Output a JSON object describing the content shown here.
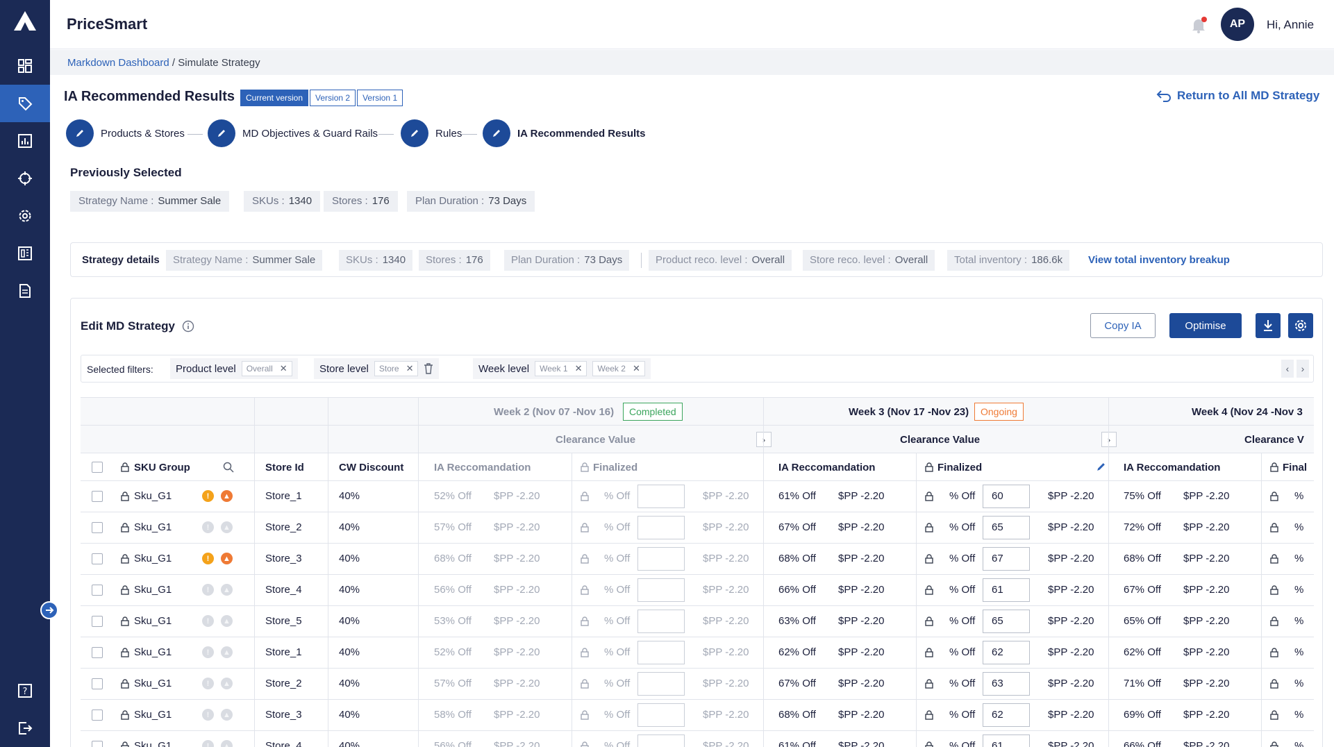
{
  "app": {
    "title": "PriceSmart"
  },
  "header": {
    "avatar_initials": "AP",
    "greeting": "Hi, Annie"
  },
  "breadcrumb": {
    "parent": "Markdown Dashboard",
    "separator": " / ",
    "current": "Simulate Strategy"
  },
  "page": {
    "title": "IA Recommended Results",
    "versions": [
      "Current version",
      "Version 2",
      "Version 1"
    ],
    "return_link": "Return to All MD Strategy"
  },
  "steps": [
    "Products & Stores",
    "MD Objectives & Guard Rails",
    "Rules",
    "IA Recommended Results"
  ],
  "previously_selected": {
    "title": "Previously Selected",
    "chips": [
      {
        "label": "Strategy Name :",
        "value": "Summer Sale"
      },
      {
        "label": "SKUs :",
        "value": "1340"
      },
      {
        "label": "Stores :",
        "value": "176"
      },
      {
        "label": "Plan Duration :",
        "value": "73 Days"
      }
    ]
  },
  "strategy_details": {
    "label": "Strategy details",
    "chips": [
      {
        "label": "Strategy Name :",
        "value": "Summer Sale"
      },
      {
        "label": "SKUs :",
        "value": "1340"
      },
      {
        "label": "Stores :",
        "value": "176"
      },
      {
        "label": "Plan Duration :",
        "value": "73 Days"
      },
      {
        "label": "Product reco. level :",
        "value": "Overall"
      },
      {
        "label": "Store reco. level :",
        "value": "Overall"
      },
      {
        "label": "Total inventory :",
        "value": "186.6k"
      }
    ],
    "breakup_link": "View total inventory breakup"
  },
  "edit_panel": {
    "title": "Edit MD Strategy",
    "copy_label": "Copy IA",
    "optimise_label": "Optimise",
    "filters_label": "Selected filters:",
    "filters": [
      {
        "name": "Product level",
        "tags": [
          "Overall"
        ]
      },
      {
        "name": "Store level",
        "tags": [
          "Store"
        ]
      },
      {
        "name": "Week level",
        "tags": [
          "Week 1",
          "Week 2"
        ]
      }
    ]
  },
  "table": {
    "columns": {
      "sku_group": "SKU Group",
      "store_id": "Store Id",
      "cw_discount": "CW Discount"
    },
    "weeks": [
      {
        "title": "Week 2 (Nov 07 -Nov 16)",
        "status": "Completed",
        "group": "Clearance Value",
        "reco_label": "IA Reccomandation",
        "final_label": "Finalized"
      },
      {
        "title": "Week 3 (Nov 17 -Nov 23)",
        "status": "Ongoing",
        "group": "Clearance Value",
        "reco_label": "IA Reccomandation",
        "final_label": "Finalized"
      },
      {
        "title": "Week 4 (Nov 24 -Nov 3",
        "status": "",
        "group": "Clearance V",
        "reco_label": "IA Reccomandation",
        "final_label": "Final"
      }
    ],
    "unit_off": "% Off",
    "unit_pct": "%",
    "rows": [
      {
        "sku": "Sku_G1",
        "store": "Store_1",
        "cw": "40%",
        "flag": true,
        "w2_reco": "52% Off",
        "w2_price": "$PP -2.20",
        "w2_fprice": "$PP -2.20",
        "w3_reco": "61% Off",
        "w3_price": "$PP -2.20",
        "w3_val": "60",
        "w3_fprice": "$PP -2.20",
        "w4_reco": "75% Off",
        "w4_price": "$PP -2.20"
      },
      {
        "sku": "Sku_G1",
        "store": "Store_2",
        "cw": "40%",
        "flag": false,
        "w2_reco": "57% Off",
        "w2_price": "$PP -2.20",
        "w2_fprice": "$PP -2.20",
        "w3_reco": "67% Off",
        "w3_price": "$PP -2.20",
        "w3_val": "65",
        "w3_fprice": "$PP -2.20",
        "w4_reco": "72% Off",
        "w4_price": "$PP -2.20"
      },
      {
        "sku": "Sku_G1",
        "store": "Store_3",
        "cw": "40%",
        "flag": true,
        "w2_reco": "68% Off",
        "w2_price": "$PP -2.20",
        "w2_fprice": "$PP -2.20",
        "w3_reco": "68% Off",
        "w3_price": "$PP -2.20",
        "w3_val": "67",
        "w3_fprice": "$PP -2.20",
        "w4_reco": "68% Off",
        "w4_price": "$PP -2.20"
      },
      {
        "sku": "Sku_G1",
        "store": "Store_4",
        "cw": "40%",
        "flag": false,
        "w2_reco": "56% Off",
        "w2_price": "$PP -2.20",
        "w2_fprice": "$PP -2.20",
        "w3_reco": "66% Off",
        "w3_price": "$PP -2.20",
        "w3_val": "61",
        "w3_fprice": "$PP -2.20",
        "w4_reco": "67% Off",
        "w4_price": "$PP -2.20"
      },
      {
        "sku": "Sku_G1",
        "store": "Store_5",
        "cw": "40%",
        "flag": false,
        "w2_reco": "53% Off",
        "w2_price": "$PP -2.20",
        "w2_fprice": "$PP -2.20",
        "w3_reco": "63% Off",
        "w3_price": "$PP -2.20",
        "w3_val": "65",
        "w3_fprice": "$PP -2.20",
        "w4_reco": "65% Off",
        "w4_price": "$PP -2.20"
      },
      {
        "sku": "Sku_G1",
        "store": "Store_1",
        "cw": "40%",
        "flag": false,
        "w2_reco": "52% Off",
        "w2_price": "$PP -2.20",
        "w2_fprice": "$PP -2.20",
        "w3_reco": "62% Off",
        "w3_price": "$PP -2.20",
        "w3_val": "62",
        "w3_fprice": "$PP -2.20",
        "w4_reco": "62% Off",
        "w4_price": "$PP -2.20"
      },
      {
        "sku": "Sku_G1",
        "store": "Store_2",
        "cw": "40%",
        "flag": false,
        "w2_reco": "57% Off",
        "w2_price": "$PP -2.20",
        "w2_fprice": "$PP -2.20",
        "w3_reco": "67% Off",
        "w3_price": "$PP -2.20",
        "w3_val": "63",
        "w3_fprice": "$PP -2.20",
        "w4_reco": "71% Off",
        "w4_price": "$PP -2.20"
      },
      {
        "sku": "Sku_G1",
        "store": "Store_3",
        "cw": "40%",
        "flag": false,
        "w2_reco": "58% Off",
        "w2_price": "$PP -2.20",
        "w2_fprice": "$PP -2.20",
        "w3_reco": "68% Off",
        "w3_price": "$PP -2.20",
        "w3_val": "62",
        "w3_fprice": "$PP -2.20",
        "w4_reco": "69% Off",
        "w4_price": "$PP -2.20"
      },
      {
        "sku": "Sku_G1",
        "store": "Store_4",
        "cw": "40%",
        "flag": false,
        "w2_reco": "56% Off",
        "w2_price": "$PP -2.20",
        "w2_fprice": "$PP -2.20",
        "w3_reco": "61% Off",
        "w3_price": "$PP -2.20",
        "w3_val": "61",
        "w3_fprice": "$PP -2.20",
        "w4_reco": "66% Off",
        "w4_price": "$PP -2.20"
      }
    ]
  },
  "colors": {
    "sidebar": "#1b2a55",
    "accent": "#2d62b8",
    "primary": "#1d4a98",
    "completed": "#3ba55c",
    "ongoing": "#ef7a35"
  }
}
